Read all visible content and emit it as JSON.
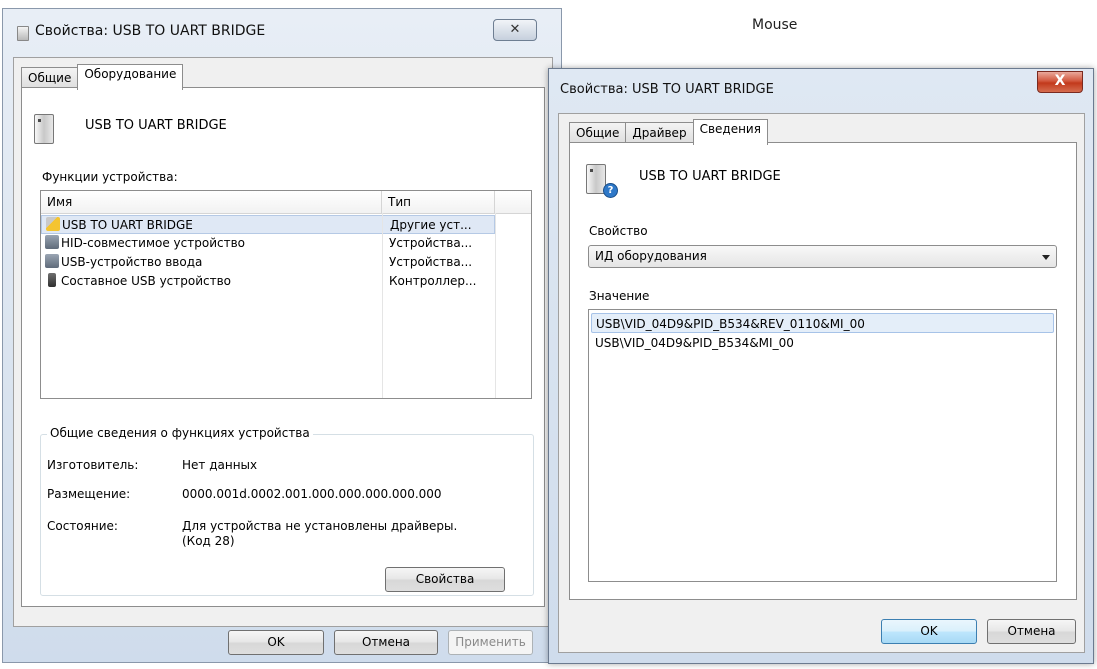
{
  "background": {
    "text": "Mouse"
  },
  "window1": {
    "title": "Свойства: USB TO UART BRIDGE",
    "close_glyph": "✕",
    "tabs": [
      {
        "label": "Общие"
      },
      {
        "label": "Оборудование"
      }
    ],
    "device_name": "USB TO UART BRIDGE",
    "functions_label": "Функции устройства:",
    "columns": {
      "name": "Имя",
      "type": "Тип"
    },
    "rows": [
      {
        "name": "USB TO UART BRIDGE",
        "type": "Другие уст...",
        "icon": "warning-device-icon"
      },
      {
        "name": "HID-совместимое устройство",
        "type": "Устройства...",
        "icon": "hid-device-icon"
      },
      {
        "name": "USB-устройство ввода",
        "type": "Устройства...",
        "icon": "hid-device-icon"
      },
      {
        "name": "Составное USB устройство",
        "type": "Контроллер...",
        "icon": "usb-plug-icon"
      }
    ],
    "summary": {
      "title": "Общие сведения о функциях устройства",
      "manufacturer_label": "Изготовитель:",
      "manufacturer_value": "Нет данных",
      "location_label": "Размещение:",
      "location_value": "0000.001d.0002.001.000.000.000.000.000",
      "status_label": "Состояние:",
      "status_value_line1": "Для устройства не установлены драйверы.",
      "status_value_line2": "(Код 28)"
    },
    "properties_button": "Свойства",
    "ok_button": "OK",
    "cancel_button": "Отмена",
    "apply_button": "Применить"
  },
  "window2": {
    "title": "Свойства: USB TO UART BRIDGE",
    "close_glyph": "X",
    "tabs": [
      {
        "label": "Общие"
      },
      {
        "label": "Драйвер"
      },
      {
        "label": "Сведения"
      }
    ],
    "device_name": "USB TO UART BRIDGE",
    "property_label": "Свойство",
    "property_selected": "ИД оборудования",
    "value_label": "Значение",
    "values": [
      "USB\\VID_04D9&PID_B534&REV_0110&MI_00",
      "USB\\VID_04D9&PID_B534&MI_00"
    ],
    "ok_button": "OK",
    "cancel_button": "Отмена"
  }
}
